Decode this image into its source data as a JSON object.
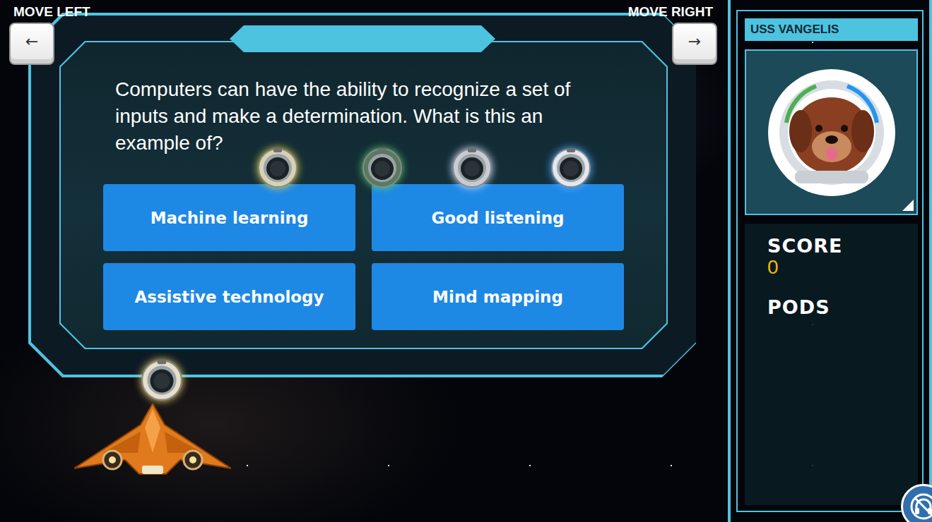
{
  "controls": {
    "left": {
      "label": "MOVE LEFT",
      "key": "←"
    },
    "right": {
      "label": "MOVE RIGHT",
      "key": "→"
    }
  },
  "question": {
    "text": "Computers can have the ability to recognize a set of inputs and make a determination. What is this an example of?"
  },
  "answers": [
    {
      "label": "Machine learning",
      "selected": false
    },
    {
      "label": "Good listening",
      "selected": false
    },
    {
      "label": "Assistive technology",
      "selected": false
    },
    {
      "label": "Mind mapping",
      "selected": false
    }
  ],
  "player": {
    "ship_name": "USS VANGELIS"
  },
  "score": {
    "label": "SCORE",
    "value": "0"
  },
  "pods": {
    "label": "PODS"
  }
}
